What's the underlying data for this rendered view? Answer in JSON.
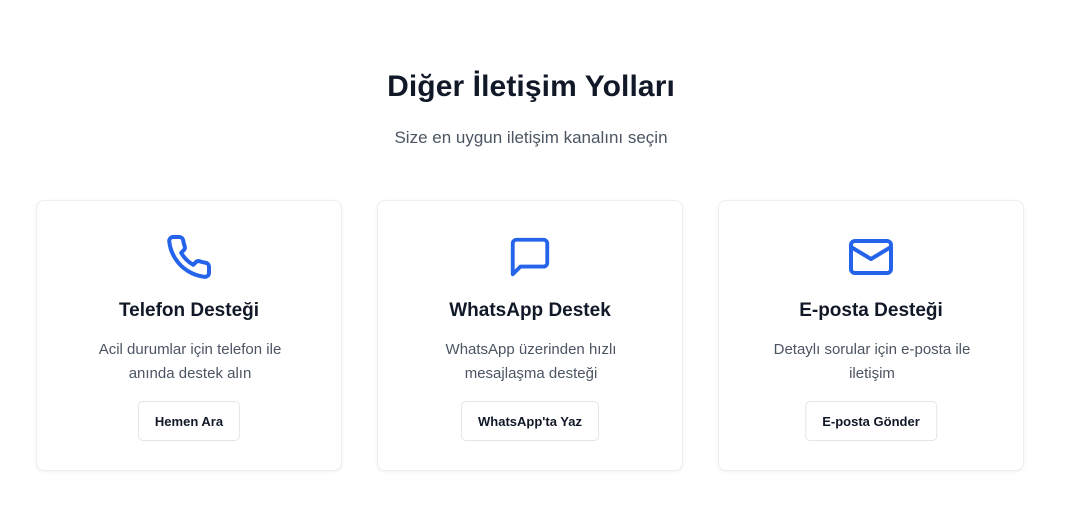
{
  "section": {
    "title": "Diğer İletişim Yolları",
    "subtitle": "Size en uygun iletişim kanalını seçin"
  },
  "theme": {
    "accent": "#2563eb",
    "text_primary": "#111827",
    "text_secondary": "#4b5563",
    "card_border": "#eceef1"
  },
  "cards": [
    {
      "icon": "phone-icon",
      "title": "Telefon Desteği",
      "description": "Acil durumlar için telefon ile anında destek alın",
      "button_label": "Hemen Ara"
    },
    {
      "icon": "message-square-icon",
      "title": "WhatsApp Destek",
      "description": "WhatsApp üzerinden hızlı mesajlaşma desteği",
      "button_label": "WhatsApp'ta Yaz"
    },
    {
      "icon": "mail-icon",
      "title": "E-posta Desteği",
      "description": "Detaylı sorular için e-posta ile iletişim",
      "button_label": "E-posta Gönder"
    }
  ]
}
